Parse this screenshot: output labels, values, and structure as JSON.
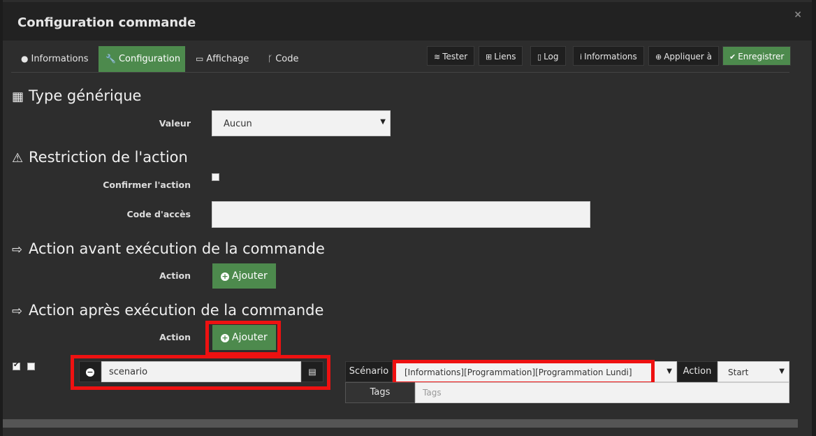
{
  "window": {
    "title": "Configuration commande",
    "close": "×"
  },
  "tabs": [
    {
      "label": "Informations",
      "icon": "info-circle-icon",
      "active": false
    },
    {
      "label": "Configuration",
      "icon": "wrench-icon",
      "active": true
    },
    {
      "label": "Affichage",
      "icon": "desktop-icon",
      "active": false
    },
    {
      "label": "Code",
      "icon": "code-fork-icon",
      "active": false
    }
  ],
  "toolbar": {
    "tester": "Tester",
    "liens": "Liens",
    "log": "Log",
    "informations": "Informations",
    "appliquer": "Appliquer à",
    "enregistrer": "Enregistrer"
  },
  "type_generique": {
    "heading": "Type générique",
    "valeur_label": "Valeur",
    "valeur_selected": "Aucun"
  },
  "restriction": {
    "heading": "Restriction de l'action",
    "confirmer_label": "Confirmer l'action",
    "code_label": "Code d'accès",
    "code_value": ""
  },
  "action_avant": {
    "heading": "Action avant exécution de la commande",
    "action_label": "Action",
    "add_label": "Ajouter"
  },
  "action_apres": {
    "heading": "Action après exécution de la commande",
    "action_label": "Action",
    "add_label": "Ajouter",
    "row": {
      "command_value": "scenario",
      "scenario_label": "Scénario",
      "scenario_value": "[Informations][Programmation][Programmation Lundi]",
      "action_label": "Action",
      "action_selected": "Start",
      "tags_label": "Tags",
      "tags_placeholder": "Tags"
    }
  },
  "colors": {
    "accent_green": "#4d8a4d",
    "highlight_red": "#e11111",
    "background": "#2d2d2d"
  }
}
